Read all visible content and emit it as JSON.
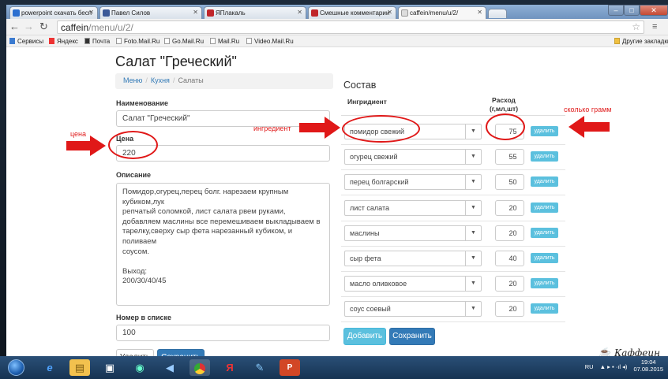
{
  "browser": {
    "tabs": [
      {
        "label": "powerpoint скачать бесп"
      },
      {
        "label": "Павел Силов"
      },
      {
        "label": "ЯПлакаль"
      },
      {
        "label": "Смешные комментарии"
      },
      {
        "label": "caffein/menu/u/2/"
      }
    ],
    "url_host": "caffein",
    "url_path": "/menu/u/2/",
    "bookmarks": [
      "Сервисы",
      "Яндекс",
      "Почта",
      "Foto.Mail.Ru",
      "Go.Mail.Ru",
      "Mail.Ru",
      "Video.Mail.Ru"
    ],
    "other_bookmarks": "Другие закладки"
  },
  "page": {
    "title": "Салат \"Греческий\"",
    "breadcrumb": [
      "Меню",
      "Кухня",
      "Салаты"
    ],
    "name_label": "Наименование",
    "name_value": "Салат \"Греческий\"",
    "price_label": "Цена",
    "price_value": "220",
    "desc_label": "Описание",
    "desc_value": "Помидор,огурец,перец болг. нарезаем крупным кубиком,лук\nрепчатый соломкой, лист салата рвем руками,\nдобавляем маслины все перемешиваем выкладываем в\nтарелку,сверху сыр фета нарезанный кубиком, и поливаем\nсоусом.\n\nВыход:\n200/30/40/45",
    "order_label": "Номер в списке",
    "order_value": "100",
    "delete_button": "Удалить",
    "save_button": "Сохранить",
    "composition_title": "Состав",
    "col_ingredient": "Ингридиент",
    "col_amount_line1": "Расход",
    "col_amount_line2": "(г,мл,шт)",
    "row_delete_label": "удалить",
    "add_button": "Добавить",
    "save_button2": "Сохранить",
    "ingredients": [
      {
        "name": "помидор свежий",
        "qty": "75"
      },
      {
        "name": "огурец свежий",
        "qty": "55"
      },
      {
        "name": "перец болгарский",
        "qty": "50"
      },
      {
        "name": "лист салата",
        "qty": "20"
      },
      {
        "name": "маслины",
        "qty": "20"
      },
      {
        "name": "сыр фета",
        "qty": "40"
      },
      {
        "name": "масло оливковое",
        "qty": "20"
      },
      {
        "name": "соус соевый",
        "qty": "20"
      }
    ],
    "logo_text": "Каффеин"
  },
  "annotations": {
    "price": "цена",
    "ingredient": "ингредиент",
    "grams": "сколько грамм"
  },
  "taskbar": {
    "lang": "RU",
    "time": "19:04",
    "date": "07.08.2015"
  },
  "colors": {
    "primary": "#337ab7",
    "info": "#5bc0de",
    "annotation": "#e01818"
  }
}
